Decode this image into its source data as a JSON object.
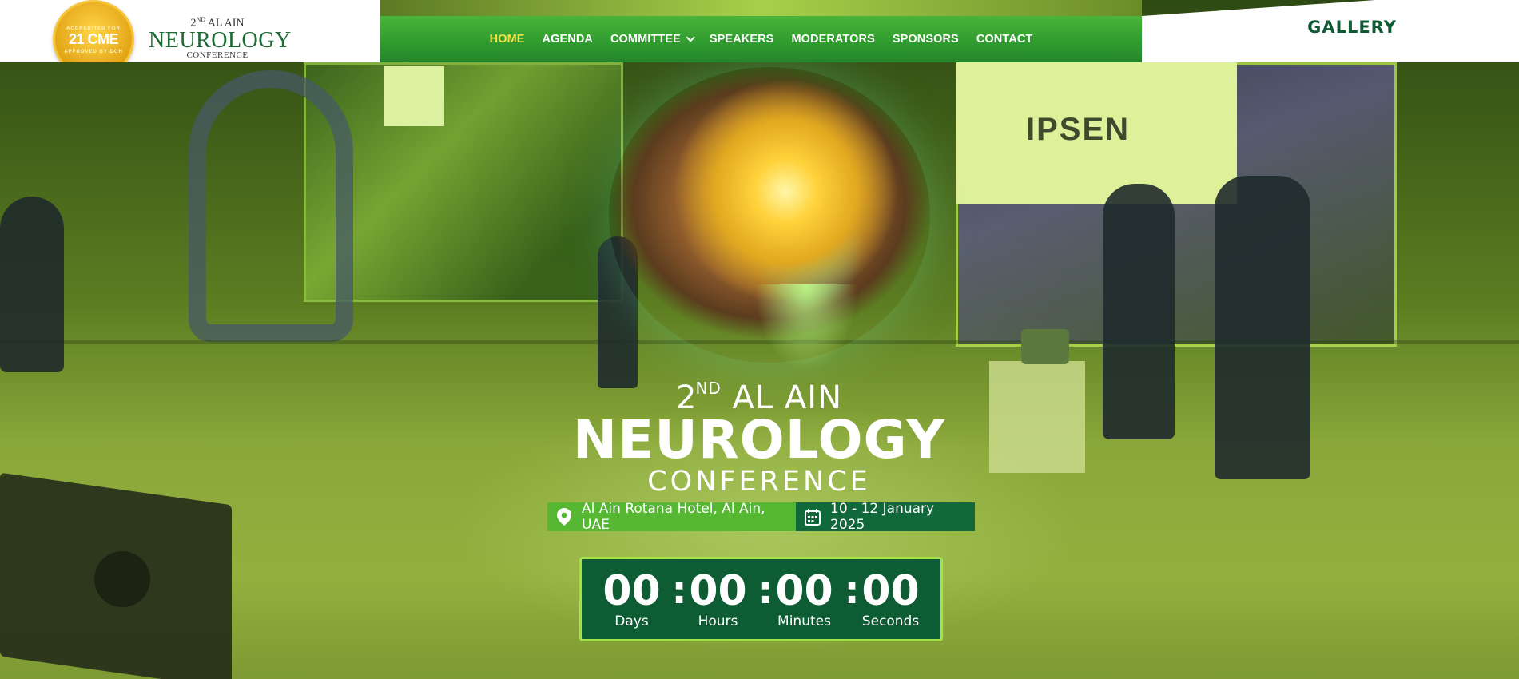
{
  "header": {
    "cme_badge": {
      "main": "21 CME",
      "top_text": "ACCREDITED FOR",
      "bottom_text": "APPROVED BY DOH"
    },
    "logo": {
      "prefix_num": "2",
      "prefix_sup": "ND",
      "line1": "AL AIN",
      "line2": "NEUROLOGY",
      "line3": "CONFERENCE"
    },
    "nav": [
      {
        "label": "HOME",
        "active": true
      },
      {
        "label": "AGENDA"
      },
      {
        "label": "COMMITTEE",
        "has_dropdown": true
      },
      {
        "label": "SPEAKERS"
      },
      {
        "label": "MODERATORS"
      },
      {
        "label": "SPONSORS"
      },
      {
        "label": "CONTACT"
      }
    ],
    "gallery_label": "GALLERY"
  },
  "hero": {
    "sponsor_logo": "IPSEN",
    "title": {
      "num": "2",
      "sup": "ND",
      "line1": "AL AIN",
      "line2": "NEUROLOGY",
      "line3": "CONFERENCE"
    },
    "location": {
      "icon": "map-pin-icon",
      "text": "Al Ain Rotana Hotel, Al Ain, UAE"
    },
    "date": {
      "icon": "calendar-icon",
      "text": "10 - 12 January 2025"
    },
    "countdown": [
      {
        "value": "00",
        "label": "Days"
      },
      {
        "value": "00",
        "label": "Hours"
      },
      {
        "value": "00",
        "label": "Minutes"
      },
      {
        "value": "00",
        "label": "Seconds"
      }
    ],
    "countdown_separator": ":"
  },
  "colors": {
    "nav_green": "#2f9a2e",
    "nav_active": "#f2e24a",
    "location_pill": "#56b733",
    "date_pill": "#11683a",
    "countdown_bg": "#0d5c33",
    "countdown_border": "#a6e04a",
    "gallery_text": "#0e5a32"
  }
}
